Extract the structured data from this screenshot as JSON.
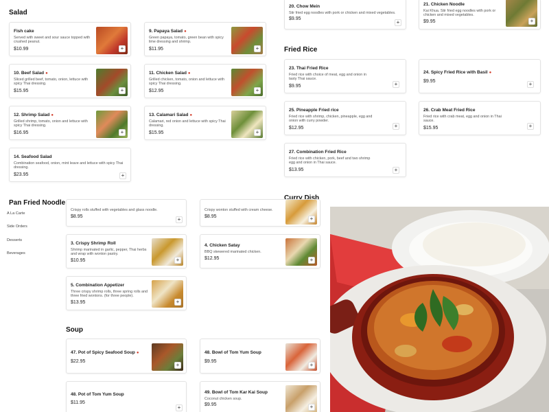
{
  "sections": {
    "salad": "Salad",
    "fried_rice": "Fried Rice",
    "pan_fried_noodle": "Pan Fried Noodle",
    "curry_dish": "Curry Dish",
    "soup": "Soup"
  },
  "side_nav": [
    "A La Carte",
    "Side Orders",
    "Desserts",
    "Beverages"
  ],
  "add_icon": "+",
  "spicy_icon": "chili-pepper-icon",
  "items": {
    "fish_cake": {
      "name": "Fish cake",
      "desc": "Served with sweet and sour sauce topped with crushed peanut.",
      "price": "$10.99"
    },
    "papaya_salad": {
      "name": "9. Papaya Salad",
      "desc": "Green papaya, tomato, green bean with spicy lime dressing and shrimp.",
      "price": "$11.95"
    },
    "beef_salad": {
      "name": "10. Beef Salad",
      "desc": "Sliced grilled beef, tomato, onion, lettuce with spicy Thai dressing.",
      "price": "$15.95"
    },
    "chicken_salad": {
      "name": "11. Chicken Salad",
      "desc": "Grilled chicken, tomato, onion and lettuce with spicy Thai dressing.",
      "price": "$12.95"
    },
    "shrimp_salad": {
      "name": "12. Shrimp Salad",
      "desc": "Grilled shrimp, tomato, onion and lettuce with spicy Thai dressing.",
      "price": "$16.95"
    },
    "calamari_salad": {
      "name": "13. Calamari Salad",
      "desc": "Calamari, red onion and lettuce with spicy Thai dressing.",
      "price": "$15.95"
    },
    "seafood_salad": {
      "name": "14. Seafood Salad",
      "desc": "Combination seafood, onion, mint leave and lettuce with spicy Thai dressing.",
      "price": "$23.95"
    },
    "chow_mein": {
      "name": "20. Chow Mein",
      "desc": "Stir fried egg noodles with pork or chicken and mixed vegetables.",
      "price": "$9.95"
    },
    "chicken_noodle": {
      "name": "21. Chicken Noodle",
      "desc": "Kai Khua. Stir fried egg noodles with pork or chicken and mixed vegetables.",
      "price": "$9.95"
    },
    "thai_fried_rice": {
      "name": "23. Thai Fried Rice",
      "desc": "Fried rice with choice of meat, egg and onion in tasty Thai sauce.",
      "price": "$9.95"
    },
    "spicy_fried_rice_basil": {
      "name": "24. Spicy Fried Rice with Basil",
      "desc": "",
      "price": "$9.95"
    },
    "pineapple_fried_rice": {
      "name": "25. Pineapple Fried rice",
      "desc": "Fried rice with shrimp, chicken, pineapple, egg and onion with curry powder.",
      "price": "$12.95"
    },
    "crab_meat_fried_rice": {
      "name": "26. Crab Meat Fried Rice",
      "desc": "Fried rice with crab meat, egg and onion in Thai sauce.",
      "price": "$15.95"
    },
    "combination_fried_rice": {
      "name": "27. Combination Fried Rice",
      "desc": "Fried rice with chicken, pork, beef and two shrimp egg and onion in Thai sauce.",
      "price": "$13.95"
    },
    "spring_rolls": {
      "name": "",
      "desc": "Crispy rolls stuffed with vegetables and glass noodle.",
      "price": "$8.95"
    },
    "crispy_wonton": {
      "name": "",
      "desc": "Crispy wonton stuffed with cream cheese.",
      "price": "$8.95"
    },
    "crispy_shrimp_roll": {
      "name": "3. Crispy Shrimp Roll",
      "desc": "Shrimp marinated in garlic, pepper, Thai herbs and wrap with wonton pastry.",
      "price": "$10.95"
    },
    "chicken_satay": {
      "name": "4. Chicken Satay",
      "desc": "BBQ skewered marinated chicken.",
      "price": "$12.95"
    },
    "combination_appetizer": {
      "name": "5. Combination Appetizer",
      "desc": "Three crispy shrimp rolls, three spring rolls and three fried wontons. (for three people).",
      "price": "$13.95"
    },
    "pot_spicy_seafood_soup": {
      "name": "47. Pot of Spicy Seafood Soup",
      "desc": "",
      "price": "$22.95"
    },
    "bowl_tom_yum": {
      "name": "48. Bowl of Tom Yum Soup",
      "desc": "",
      "price": "$9.95"
    },
    "pot_tom_yum": {
      "name": "48. Pot of Tom Yum Soup",
      "desc": "",
      "price": "$11.95"
    },
    "bowl_tom_kar_kai": {
      "name": "49. Bowl of Tom Kar Kai Soup",
      "desc": "Coconut chicken soup.",
      "price": "$9.95"
    }
  },
  "colors": {
    "chili": "#d23c2a",
    "border": "#e3e3e3"
  }
}
